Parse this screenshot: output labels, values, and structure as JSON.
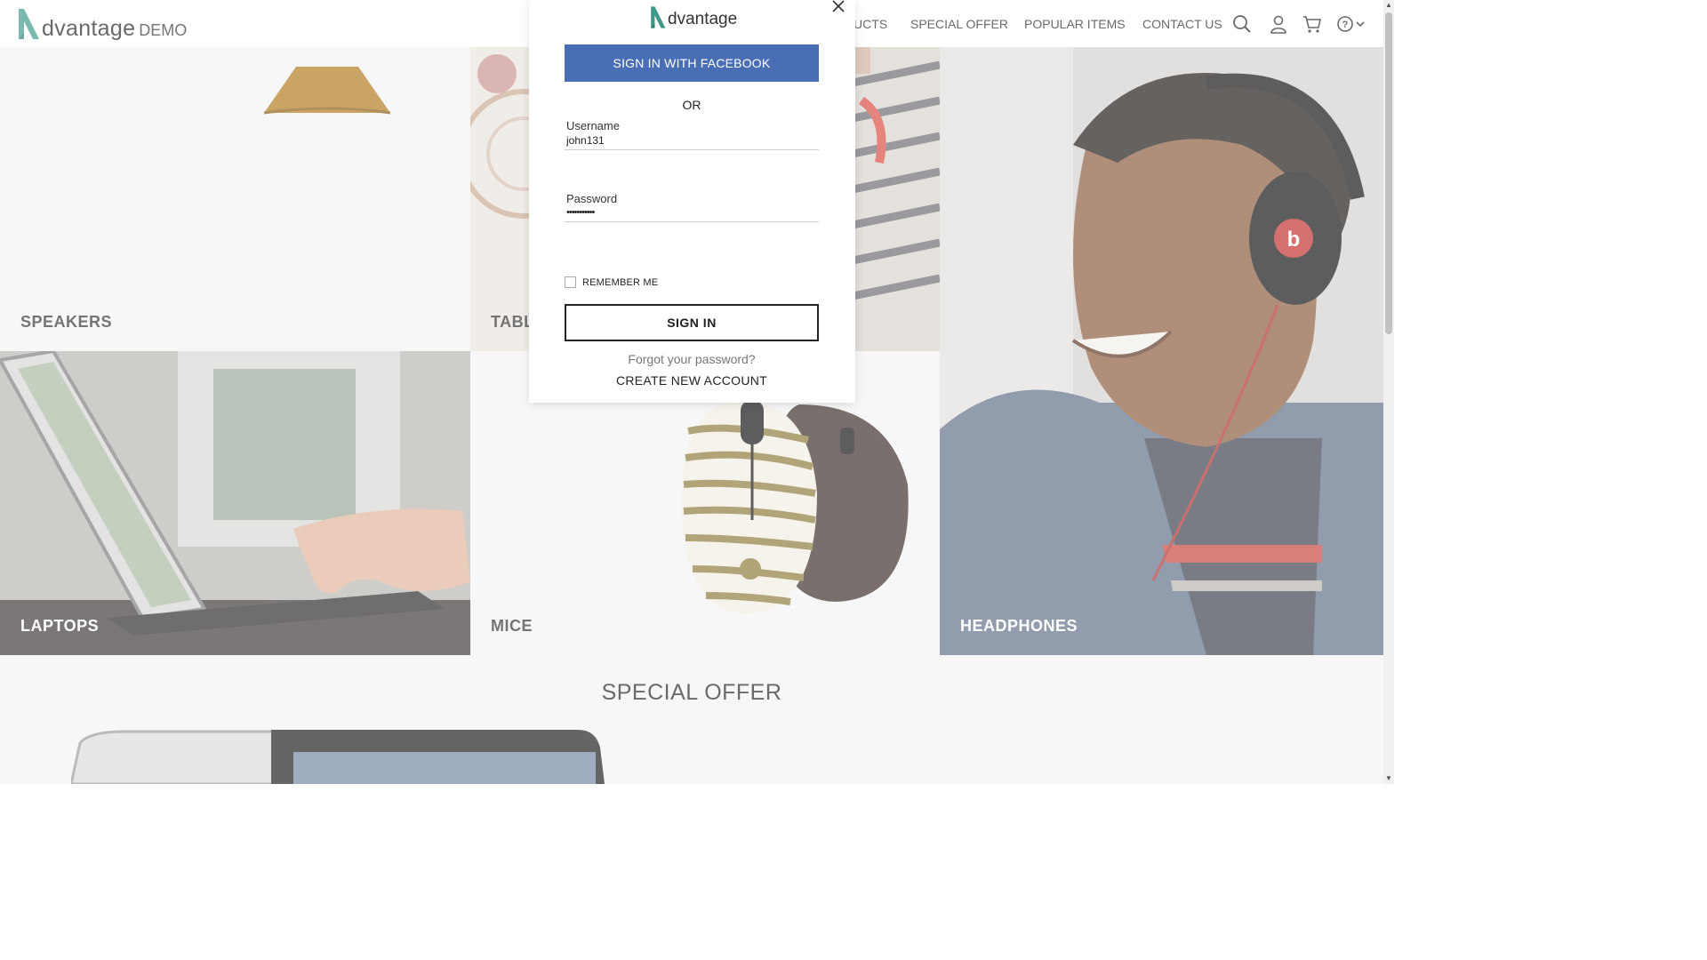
{
  "header": {
    "brand": "dvantage",
    "demo": "DEMO",
    "nav": [
      "UCTS",
      "SPECIAL OFFER",
      "POPULAR ITEMS",
      "CONTACT US"
    ],
    "icons": [
      "search-icon",
      "user-icon",
      "cart-icon",
      "help-icon",
      "chevron-down-icon"
    ]
  },
  "tiles": {
    "speakers": "SPEAKERS",
    "tablets": "TABL",
    "laptops": "LAPTOPS",
    "mice": "MICE",
    "headphones": "HEADPHONES"
  },
  "special_offer": {
    "title": "SPECIAL OFFER"
  },
  "modal": {
    "brand": "dvantage",
    "facebook_label": "SIGN IN WITH FACEBOOK",
    "or_label": "OR",
    "username_label": "Username",
    "username_value": "john131",
    "password_label": "Password",
    "password_value": "•••••••••••",
    "remember_label": "REMEMBER ME",
    "remember_checked": false,
    "signin_label": "SIGN IN",
    "forgot_label": "Forgot your password?",
    "create_label": "CREATE NEW ACCOUNT"
  },
  "colors": {
    "brand_teal": "#3d9a8b",
    "facebook_blue": "#4a6eb3"
  }
}
